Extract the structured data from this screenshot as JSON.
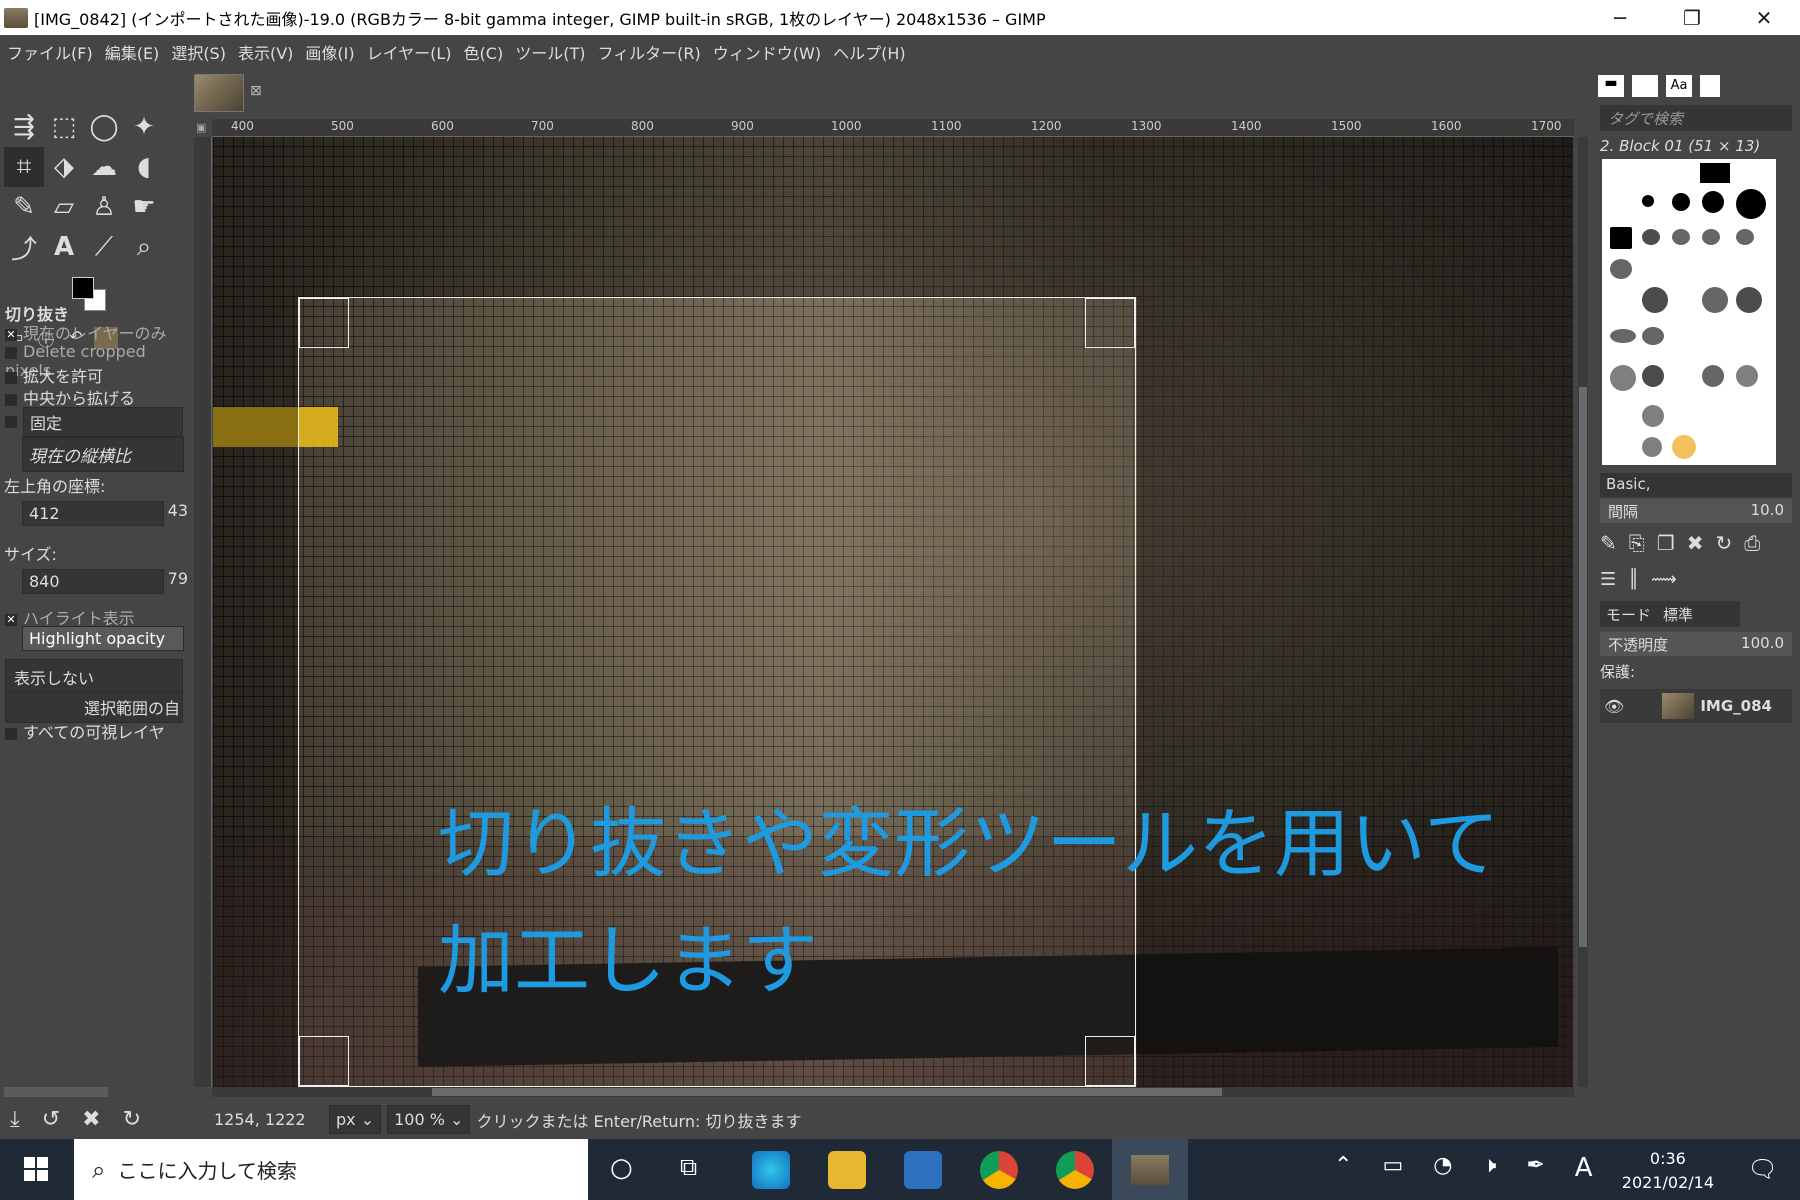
{
  "window": {
    "title": "[IMG_0842] (インポートされた画像)-19.0 (RGBカラー 8-bit gamma integer, GIMP built-in sRGB, 1枚のレイヤー) 2048x1536 – GIMP",
    "minimize": "─",
    "maximize": "❐",
    "close": "✕"
  },
  "menu": [
    "ファイル(F)",
    "編集(E)",
    "選択(S)",
    "表示(V)",
    "画像(I)",
    "レイヤー(L)",
    "色(C)",
    "ツール(T)",
    "フィルター(R)",
    "ウィンドウ(W)",
    "ヘルプ(H)"
  ],
  "tool_options": {
    "tool_name": "切り抜き",
    "current_layer_only": "現在のレイヤーのみ",
    "delete_cropped": "Delete cropped pixels",
    "allow_growing": "拡大を許可",
    "expand_from_center": "中央から拡げる",
    "fixed": "固定",
    "aspect_mode": "現在の縦横比",
    "position_label": "左上角の座標:",
    "position_x": "412",
    "position_y_partial": "43",
    "size_label": "サイズ:",
    "size_w": "840",
    "size_h_partial": "79",
    "highlight": "ハイライト表示",
    "highlight_opacity": "Highlight opacity",
    "guides": "表示しない",
    "auto_shrink": "選択範囲の自",
    "all_visible_layers": "すべての可視レイヤ"
  },
  "ruler": [
    "400",
    "500",
    "600",
    "700",
    "800",
    "900",
    "1000",
    "1100",
    "1200",
    "1300",
    "1400",
    "1500",
    "1600",
    "1700"
  ],
  "caption": {
    "line1": "切り抜きや変形ツールを用いて",
    "line2": "加工します"
  },
  "status": {
    "coords": "1254, 1222",
    "unit": "px",
    "zoom": "100 %",
    "message": "クリックまたは Enter/Return: 切り抜きます"
  },
  "brushes": {
    "tag_search": "タグで検索",
    "brush_name": "2. Block 01 (51 × 13)",
    "preset": "Basic,",
    "spacing_label": "間隔",
    "spacing_value": "10.0"
  },
  "layers": {
    "mode_label": "モード",
    "mode_value": "標準",
    "opacity_label": "不透明度",
    "opacity_value": "100.0",
    "lock_label": "保護:",
    "layer_name": "IMG_084"
  },
  "taskbar": {
    "search_placeholder": "ここに入力して検索",
    "time": "0:36",
    "date": "2021/02/14",
    "ime": "A"
  }
}
